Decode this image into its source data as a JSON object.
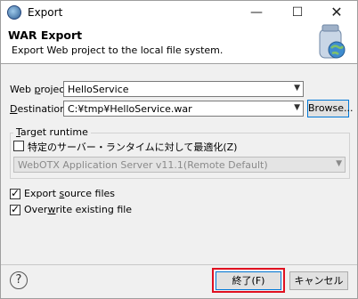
{
  "window": {
    "title": "Export",
    "min_glyph": "—",
    "max_glyph": "☐",
    "close_glyph": "✕"
  },
  "banner": {
    "title": "WAR Export",
    "description": "Export Web project to the local file system."
  },
  "web_project": {
    "label_pre": "Web ",
    "label_key": "p",
    "label_post": "roject:",
    "value": "HelloService"
  },
  "destination": {
    "label_key": "D",
    "label_post": "estination:",
    "value": "C:¥tmp¥HelloService.war",
    "browse_label": "Browse..."
  },
  "target_runtime": {
    "title_key": "T",
    "title_post": "arget runtime",
    "optimize_label": "特定のサーバー・ランタイムに対して最適化(Z)",
    "optimize_checked": false,
    "runtime_value": "WebOTX Application Server v11.1(Remote Default)"
  },
  "export_source": {
    "label_pre": "Export ",
    "label_key": "s",
    "label_post": "ource files",
    "checked": true
  },
  "overwrite": {
    "label_pre": "Over",
    "label_key": "w",
    "label_post": "rite existing file",
    "checked": true
  },
  "footer": {
    "help_glyph": "?",
    "finish_label": "終了(F)",
    "cancel_label": "キャンセル"
  },
  "colors": {
    "highlight": "#e01020",
    "focus": "#0078d7"
  }
}
